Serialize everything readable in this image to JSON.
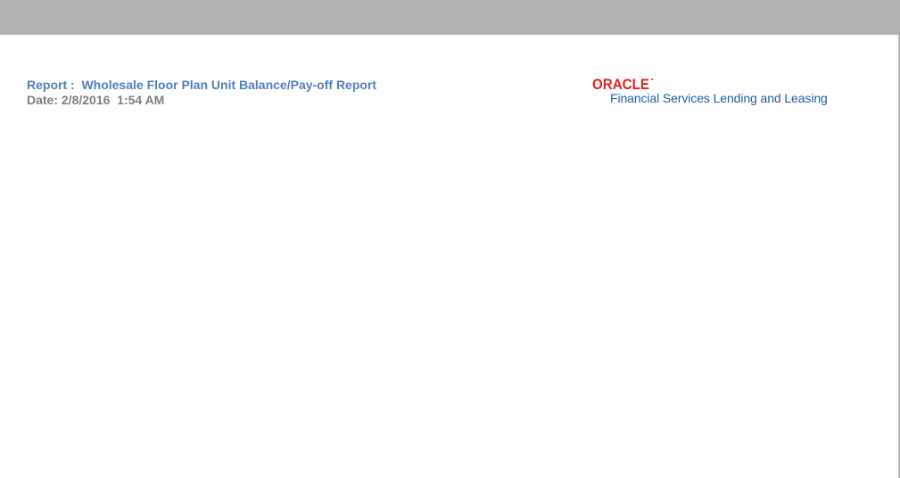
{
  "report": {
    "title": "Report :  Wholesale Floor Plan Unit Balance/Pay-off Report",
    "date": "Date: 2/8/2016  1:54 AM"
  },
  "brand": {
    "logo_text": "ORACLE",
    "logo_color": "#e2231a",
    "tagline": "Financial Services Lending and Leasing",
    "tagline_color": "#1f5fa8"
  },
  "colors": {
    "top_bar": "#b2b2b2",
    "title": "#4f81bd",
    "date": "#7f7f7f"
  }
}
